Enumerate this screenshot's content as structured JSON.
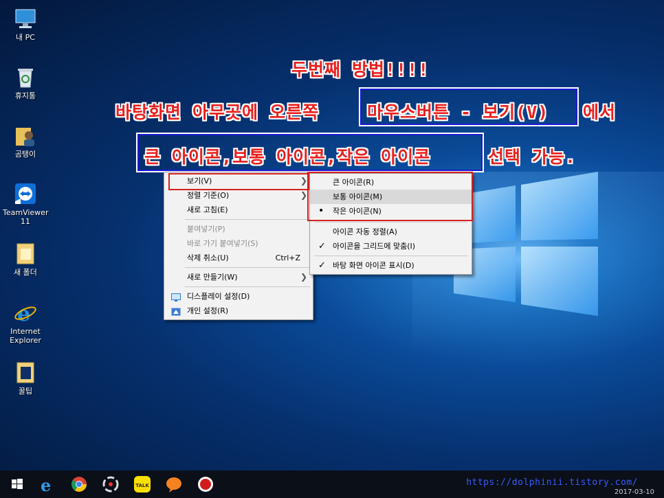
{
  "desktop": {
    "icons": [
      {
        "label": "내 PC",
        "icon": "this-pc-icon"
      },
      {
        "label": "휴지통",
        "icon": "recycle-bin-icon"
      },
      {
        "label": "곰탱이",
        "icon": "user-folder-icon"
      },
      {
        "label": "TeamViewer\n11",
        "icon": "teamviewer-icon"
      },
      {
        "label": "새 폴더",
        "icon": "folder-icon"
      },
      {
        "label": "Internet\nExplorer",
        "icon": "internet-explorer-icon"
      },
      {
        "label": "꿀팁",
        "icon": "folder-icon"
      }
    ]
  },
  "banner": {
    "line1": "두번째 방법!!!!",
    "line2_prefix": "바탕화면 아무곳에 오른쪽",
    "line2_boxed": "마우스버튼 - 보기(V)",
    "line2_suffix": "에서",
    "line3_boxed": "큰 아이콘,보통 아이콘,작은 아이콘",
    "line3_suffix": "선택 가능."
  },
  "context_menu": {
    "items": [
      {
        "label": "보기(V)",
        "has_submenu": true
      },
      {
        "label": "정렬 기준(O)",
        "has_submenu": true
      },
      {
        "label": "새로 고침(E)"
      },
      {
        "label": "붙여넣기(P)",
        "disabled": true
      },
      {
        "label": "바로 가기 붙여넣기(S)",
        "disabled": true
      },
      {
        "label": "삭제 취소(U)",
        "shortcut": "Ctrl+Z"
      },
      {
        "label": "새로 만들기(W)",
        "has_submenu": true
      },
      {
        "label": "디스플레이 설정(D)",
        "icon": "display-settings-icon"
      },
      {
        "label": "개인 설정(R)",
        "icon": "personalize-icon"
      }
    ]
  },
  "view_submenu": {
    "items": [
      {
        "label": "큰 아이콘(R)"
      },
      {
        "label": "보통 아이콘(M)",
        "highlighted": true
      },
      {
        "label": "작은 아이콘(N)",
        "selected": true
      },
      {
        "label": "아이콘 자동 정렬(A)"
      },
      {
        "label": "아이콘을 그리드에 맞춤(I)",
        "checked": true
      },
      {
        "label": "바탕 화면 아이콘 표시(D)",
        "checked": true
      }
    ]
  },
  "taskbar": {
    "apps": [
      "start-icon",
      "edge-icon",
      "chrome-icon",
      "media-app-icon",
      "kakaotalk-icon",
      "chat-bubble-icon",
      "record-icon"
    ],
    "kakao_label": "TALK",
    "clock": "2017-03-10"
  },
  "watermark": "https://dolphinii.tistory.com/",
  "colors": {
    "banner_red": "#e8201e",
    "box_blue": "#1a1ad6",
    "frame_red": "#d42020"
  }
}
